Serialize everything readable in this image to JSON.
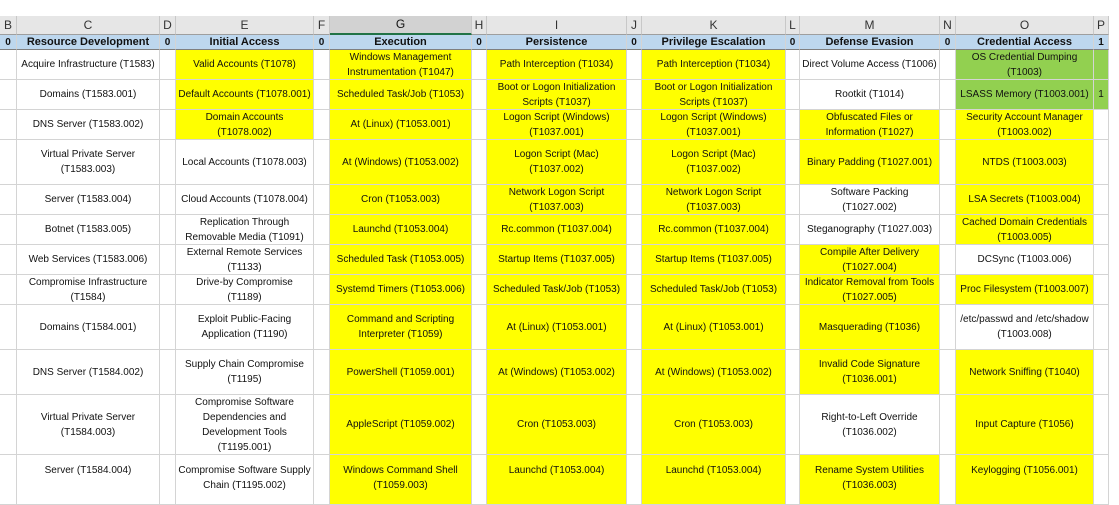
{
  "colors": {
    "yellow": "#ffff00",
    "green": "#92d050",
    "white": "#ffffff",
    "header_blue": "#bdd7ee",
    "column_header_gray": "#e6e6e6"
  },
  "columns": [
    {
      "letter": "B",
      "header": "0",
      "bg": "white",
      "cells": [
        "",
        "",
        "",
        "",
        "",
        "",
        "",
        "",
        "",
        "",
        "",
        ""
      ]
    },
    {
      "letter": "C",
      "header": "Resource Development",
      "bg": "white",
      "cells": [
        "Acquire Infrastructure (T1583)",
        "Domains (T1583.001)",
        "DNS Server (T1583.002)",
        "Virtual Private Server (T1583.003)",
        "Server (T1583.004)",
        "Botnet (T1583.005)",
        "Web Services (T1583.006)",
        "Compromise Infrastructure (T1584)",
        "Domains (T1584.001)",
        "DNS Server (T1584.002)",
        "Virtual Private Server (T1584.003)",
        "Server (T1584.004)"
      ]
    },
    {
      "letter": "D",
      "header": "0",
      "bg": "white",
      "cells": [
        "",
        "",
        "",
        "",
        "",
        "",
        "",
        "",
        "",
        "",
        "",
        ""
      ]
    },
    {
      "letter": "E",
      "header": "Initial Access",
      "bg": "white",
      "cells": [
        "Valid Accounts (T1078)",
        "Default Accounts (T1078.001)",
        "Domain Accounts (T1078.002)",
        "Local Accounts (T1078.003)",
        "Cloud Accounts (T1078.004)",
        "Replication Through Removable Media (T1091)",
        "External Remote Services (T1133)",
        "Drive-by Compromise (T1189)",
        "Exploit Public-Facing Application (T1190)",
        "Supply Chain Compromise (T1195)",
        "Compromise Software Dependencies and Development Tools (T1195.001)",
        "Compromise Software Supply Chain (T1195.002)"
      ]
    },
    {
      "letter": "F",
      "header": "0",
      "bg": "white",
      "cells": [
        "",
        "",
        "",
        "",
        "",
        "",
        "",
        "",
        "",
        "",
        "",
        ""
      ]
    },
    {
      "letter": "G",
      "header": "Execution",
      "bg": "yellow",
      "cells": [
        "Windows Management Instrumentation (T1047)",
        "Scheduled Task/Job (T1053)",
        "At (Linux) (T1053.001)",
        "At (Windows) (T1053.002)",
        "Cron (T1053.003)",
        "Launchd (T1053.004)",
        "Scheduled Task (T1053.005)",
        "Systemd Timers (T1053.006)",
        "Command and Scripting Interpreter (T1059)",
        "PowerShell (T1059.001)",
        "AppleScript (T1059.002)",
        "Windows Command Shell (T1059.003)"
      ]
    },
    {
      "letter": "H",
      "header": "0",
      "bg": "white",
      "cells": [
        "",
        "",
        "",
        "",
        "",
        "",
        "",
        "",
        "",
        "",
        "",
        ""
      ]
    },
    {
      "letter": "I",
      "header": "Persistence",
      "bg": "yellow",
      "cells": [
        "Path Interception (T1034)",
        "Boot or Logon Initialization Scripts (T1037)",
        "Logon Script (Windows) (T1037.001)",
        "Logon Script (Mac) (T1037.002)",
        "Network Logon Script (T1037.003)",
        "Rc.common (T1037.004)",
        "Startup Items (T1037.005)",
        "Scheduled Task/Job (T1053)",
        "At (Linux) (T1053.001)",
        "At (Windows) (T1053.002)",
        "Cron (T1053.003)",
        "Launchd (T1053.004)"
      ]
    },
    {
      "letter": "J",
      "header": "0",
      "bg": "white",
      "cells": [
        "",
        "",
        "",
        "",
        "",
        "",
        "",
        "",
        "",
        "",
        "",
        ""
      ]
    },
    {
      "letter": "K",
      "header": "Privilege Escalation",
      "bg": "yellow",
      "cells": [
        "Path Interception (T1034)",
        "Boot or Logon Initialization Scripts (T1037)",
        "Logon Script (Windows) (T1037.001)",
        "Logon Script (Mac) (T1037.002)",
        "Network Logon Script (T1037.003)",
        "Rc.common (T1037.004)",
        "Startup Items (T1037.005)",
        "Scheduled Task/Job (T1053)",
        "At (Linux) (T1053.001)",
        "At (Windows) (T1053.002)",
        "Cron (T1053.003)",
        "Launchd (T1053.004)"
      ]
    },
    {
      "letter": "L",
      "header": "0",
      "bg": "white",
      "cells": [
        "",
        "",
        "",
        "",
        "",
        "",
        "",
        "",
        "",
        "",
        "",
        ""
      ]
    },
    {
      "letter": "M",
      "header": "Defense Evasion",
      "bg": "white",
      "cells": [
        "Direct Volume Access (T1006)",
        "Rootkit (T1014)",
        "Obfuscated Files or Information (T1027)",
        "Binary Padding (T1027.001)",
        "Software Packing (T1027.002)",
        "Steganography (T1027.003)",
        "Compile After Delivery (T1027.004)",
        "Indicator Removal from Tools (T1027.005)",
        "Masquerading (T1036)",
        "Invalid Code Signature (T1036.001)",
        "Right-to-Left Override (T1036.002)",
        "Rename System Utilities (T1036.003)"
      ]
    },
    {
      "letter": "N",
      "header": "0",
      "bg": "white",
      "cells": [
        "",
        "",
        "",
        "",
        "",
        "",
        "",
        "",
        "",
        "",
        "",
        ""
      ]
    },
    {
      "letter": "O",
      "header": "Credential Access",
      "bg": "yellow",
      "cells": [
        "OS Credential Dumping (T1003)",
        "LSASS Memory (T1003.001)",
        "Security Account Manager (T1003.002)",
        "NTDS (T1003.003)",
        "LSA Secrets (T1003.004)",
        "Cached Domain Credentials (T1003.005)",
        "DCSync (T1003.006)",
        "Proc Filesystem (T1003.007)",
        "/etc/passwd and /etc/shadow (T1003.008)",
        "Network Sniffing (T1040)",
        "Input Capture (T1056)",
        "Keylogging (T1056.001)"
      ]
    },
    {
      "letter": "P",
      "header": "1",
      "bg": "white",
      "cells": [
        "",
        "1",
        "",
        "",
        "",
        "",
        "",
        "",
        "",
        "",
        "",
        ""
      ]
    }
  ],
  "cell_colors": {
    "C": [
      "white",
      "white",
      "white",
      "white",
      "white",
      "white",
      "white",
      "white",
      "white",
      "white",
      "white",
      "white"
    ],
    "E": [
      "yellow",
      "yellow",
      "yellow",
      "white",
      "white",
      "white",
      "white",
      "white",
      "white",
      "white",
      "white",
      "white"
    ],
    "M": [
      "white",
      "white",
      "yellow",
      "yellow",
      "white",
      "white",
      "yellow",
      "yellow",
      "yellow",
      "yellow",
      "white",
      "yellow"
    ],
    "O": [
      "green",
      "green",
      "yellow",
      "yellow",
      "yellow",
      "yellow",
      "white",
      "yellow",
      "white",
      "yellow",
      "yellow",
      "yellow"
    ],
    "P": [
      "green",
      "green",
      "white",
      "white",
      "white",
      "white",
      "white",
      "white",
      "white",
      "white",
      "white",
      "white"
    ]
  },
  "selected_column": "G"
}
